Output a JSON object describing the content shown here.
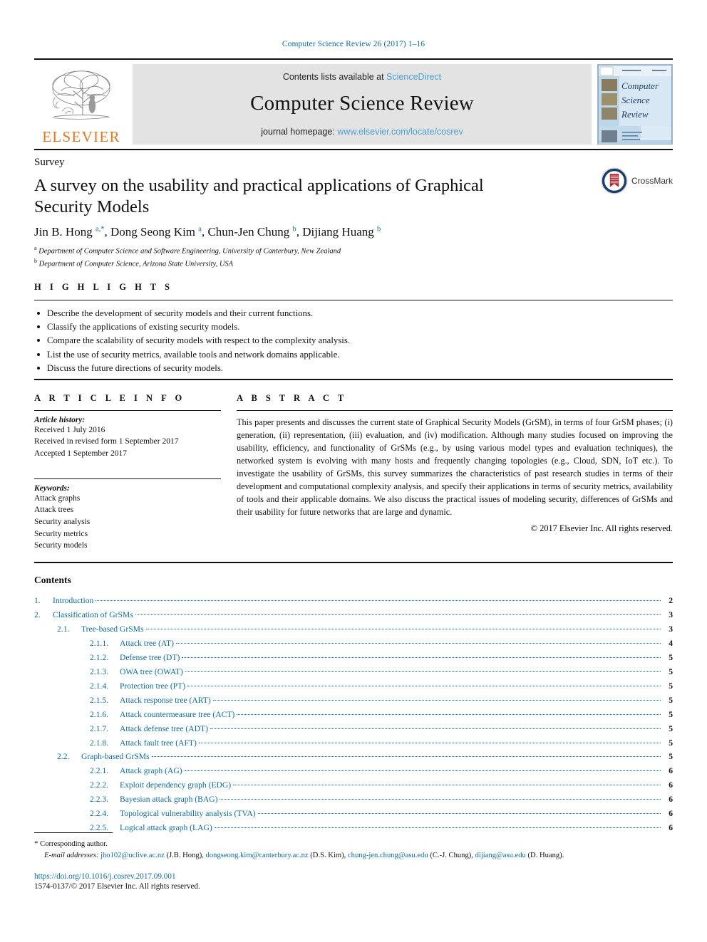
{
  "running_head": "Computer Science Review 26 (2017) 1–16",
  "masthead": {
    "publisher_name": "ELSEVIER",
    "contents_prefix": "Contents lists available at ",
    "contents_link": "ScienceDirect",
    "journal_title": "Computer Science Review",
    "homepage_prefix": "journal homepage: ",
    "homepage_link": "www.elsevier.com/locate/cosrev",
    "cover_title_line1": "Computer",
    "cover_title_line2": "Science",
    "cover_title_line3": "Review",
    "accent_blue": "#0f6a9c",
    "link_blue": "#4a9fd0",
    "elsevier_orange": "#E87722"
  },
  "article": {
    "section_type": "Survey",
    "title": "A survey on the usability and practical applications of Graphical Security Models",
    "authors_html": "Jin B. Hong <sup>a,*</sup>, Dong Seong Kim <sup>a</sup>, Chun-Jen Chung <sup>b</sup>, Dijiang Huang <sup>b</sup>",
    "affiliation_a": "Department of Computer Science and Software Engineering, University of Canterbury, New Zealand",
    "affiliation_b": "Department of Computer Science, Arizona State University, USA",
    "crossmark_label": "CrossMark"
  },
  "highlights": {
    "heading": "H I G H L I G H T S",
    "items": [
      "Describe the development of security models and their current functions.",
      "Classify the applications of existing security models.",
      "Compare the scalability of security models with respect to the complexity analysis.",
      "List the use of security metrics, available tools and network domains applicable.",
      "Discuss the future directions of security models."
    ]
  },
  "article_info": {
    "heading": "A R T I C L E    I N F O",
    "history_label": "Article history:",
    "history": [
      "Received 1 July 2016",
      "Received in revised form 1 September 2017",
      "Accepted 1 September 2017"
    ],
    "keywords_label": "Keywords:",
    "keywords": [
      "Attack graphs",
      "Attack trees",
      "Security analysis",
      "Security metrics",
      "Security models"
    ]
  },
  "abstract": {
    "heading": "A B S T R A C T",
    "text": "This paper presents and discusses the current state of Graphical Security Models (GrSM), in terms of four GrSM phases; (i) generation, (ii) representation, (iii) evaluation, and (iv) modification. Although many studies focused on improving the usability, efficiency, and functionality of GrSMs (e.g., by using various model types and evaluation techniques), the networked system is evolving with many hosts and frequently changing topologies (e.g., Cloud, SDN, IoT etc.). To investigate the usability of GrSMs, this survey summarizes the characteristics of past research studies in terms of their development and computational complexity analysis, and specify their applications in terms of security metrics, availability of tools and their applicable domains. We also discuss the practical issues of modeling security, differences of GrSMs and their usability for future networks that are large and dynamic.",
    "copyright": "© 2017 Elsevier Inc. All rights reserved."
  },
  "contents": {
    "heading": "Contents",
    "entries": [
      {
        "level": 1,
        "number": "1.",
        "label": "Introduction",
        "page": "2"
      },
      {
        "level": 1,
        "number": "2.",
        "label": "Classification of GrSMs",
        "page": "3"
      },
      {
        "level": 2,
        "number": "2.1.",
        "label": "Tree-based GrSMs",
        "page": "3"
      },
      {
        "level": 3,
        "number": "2.1.1.",
        "label": "Attack tree (AT)",
        "page": "4"
      },
      {
        "level": 3,
        "number": "2.1.2.",
        "label": "Defense tree (DT)",
        "page": "5"
      },
      {
        "level": 3,
        "number": "2.1.3.",
        "label": "OWA tree (OWAT)",
        "page": "5"
      },
      {
        "level": 3,
        "number": "2.1.4.",
        "label": "Protection tree (PT)",
        "page": "5"
      },
      {
        "level": 3,
        "number": "2.1.5.",
        "label": "Attack response tree (ART)",
        "page": "5"
      },
      {
        "level": 3,
        "number": "2.1.6.",
        "label": "Attack countermeasure tree (ACT)",
        "page": "5"
      },
      {
        "level": 3,
        "number": "2.1.7.",
        "label": "Attack defense tree (ADT)",
        "page": "5"
      },
      {
        "level": 3,
        "number": "2.1.8.",
        "label": "Attack fault tree (AFT)",
        "page": "5"
      },
      {
        "level": 2,
        "number": "2.2.",
        "label": "Graph-based GrSMs",
        "page": "5"
      },
      {
        "level": 3,
        "number": "2.2.1.",
        "label": "Attack graph (AG)",
        "page": "6"
      },
      {
        "level": 3,
        "number": "2.2.2.",
        "label": "Exploit dependency graph (EDG)",
        "page": "6"
      },
      {
        "level": 3,
        "number": "2.2.3.",
        "label": "Bayesian attack graph (BAG)",
        "page": "6"
      },
      {
        "level": 3,
        "number": "2.2.4.",
        "label": "Topological vulnerability analysis (TVA)",
        "page": "6"
      },
      {
        "level": 3,
        "number": "2.2.5.",
        "label": "Logical attack graph (LAG)",
        "page": "6"
      }
    ]
  },
  "footer": {
    "corresponding_marker": "*",
    "corresponding_text": "Corresponding author.",
    "email_label": "E-mail addresses:",
    "emails": [
      {
        "address": "jho102@uclive.ac.nz",
        "name": "(J.B. Hong),"
      },
      {
        "address": "dongseong.kim@canterbury.ac.nz",
        "name": "(D.S. Kim),"
      },
      {
        "address": "chung-jen.chung@asu.edu",
        "name": "(C.-J. Chung),"
      },
      {
        "address": "dijiang@asu.edu",
        "name": "(D. Huang)."
      }
    ],
    "doi": "https://doi.org/10.1016/j.cosrev.2017.09.001",
    "issn_line": "1574-0137/© 2017 Elsevier Inc. All rights reserved."
  }
}
